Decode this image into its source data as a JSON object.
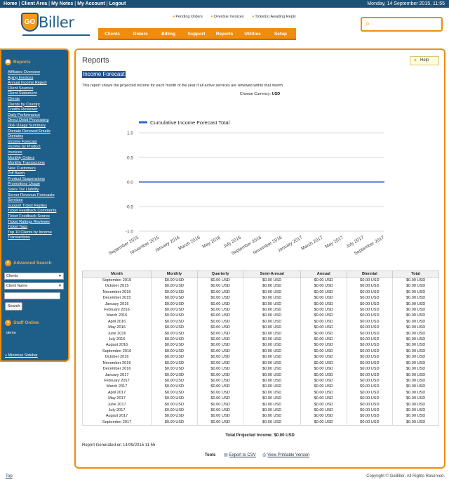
{
  "topbar": {
    "links": [
      "Home",
      "Client Area",
      "My Notes",
      "My Account",
      "Logout"
    ],
    "date": "Monday, 14 September 2015, 11:55"
  },
  "logo": {
    "text": "Biller",
    "badge": "GO"
  },
  "alerts": [
    "Pending Orders",
    "Overdue Invoices",
    "Ticket(s) Awaiting Reply"
  ],
  "nav": [
    "Clients",
    "Orders",
    "Billing",
    "Support",
    "Reports",
    "Utilities",
    "Setup"
  ],
  "sidebar": {
    "reports_heading": "Reports",
    "reports": [
      "Affiliates Overview",
      "Aging Invoices",
      "Annual Income Report",
      "Client Sources",
      "Client Statement",
      "Clients",
      "Clients by Country",
      "Credits Reviewer",
      "Daily Performance",
      "Direct Debit Processing",
      "Disk Usage Summary",
      "Domain Renewal Emails",
      "Domains",
      "Income Forecast",
      "Income by Product",
      "Invoices",
      "Monthly Orders",
      "Monthly Transactions",
      "New Customers",
      "Pdf Batch",
      "Product Suspensions",
      "Promotions Usage",
      "Sales Tax Liability",
      "Server Revenue Forecasts",
      "Services",
      "Support Ticket Replies",
      "Ticket Feedback Comments",
      "Ticket Feedback Scores",
      "Ticket Ratings Reviewer",
      "Ticket Tags",
      "Top 10 Clients by Income",
      "Transactions"
    ],
    "search_heading": "Advanced Search",
    "search_type": "Clients",
    "search_field": "Client Name",
    "search_button": "Search",
    "staff_heading": "Staff Online",
    "staff": "demo",
    "minimise": "« Minimise Sidebar"
  },
  "main": {
    "title": "Reports",
    "help": "Help",
    "report_name": "Income Forecast",
    "description": "This report shows the projected income for each month of the year if all active services are renewed within that month",
    "currency_label": "Choose Currency:",
    "currency": "USD",
    "total": "Total Projected Income: $0.00 USD",
    "generated": "Report Generated on 14/09/2015 11:55",
    "tools_label": "Tools",
    "export_csv": "Export to CSV",
    "printable": "View Printable Version"
  },
  "chart_data": {
    "type": "line",
    "series": [
      {
        "name": "Cumulative Income Forecast Total",
        "color": "#3366cc",
        "values": [
          0,
          0,
          0,
          0,
          0,
          0,
          0,
          0,
          0,
          0,
          0,
          0,
          0,
          0,
          0,
          0,
          0,
          0,
          0,
          0,
          0,
          0,
          0,
          0,
          0
        ]
      }
    ],
    "x_ticks": [
      "September 2015",
      "November 2015",
      "January 2016",
      "March 2016",
      "May 2016",
      "July 2016",
      "September 2016",
      "November 2016",
      "January 2017",
      "March 2017",
      "May 2017",
      "July 2017",
      "September 2017"
    ],
    "y_ticks": [
      "1.0",
      "0.5",
      "0.0",
      "-0.5",
      "-1.0"
    ],
    "ylim": [
      -1,
      1
    ],
    "legend_position": "top-left"
  },
  "table": {
    "headers": [
      "Month",
      "Monthly",
      "Quarterly",
      "Semi-Annual",
      "Annual",
      "Biennial",
      "Total"
    ],
    "rows": [
      [
        "September 2015",
        "$0.00 USD",
        "$0.00 USD",
        "$0.00 USD",
        "$0.00 USD",
        "$0.00 USD",
        "$0.00 USD"
      ],
      [
        "October 2015",
        "$0.00 USD",
        "$0.00 USD",
        "$0.00 USD",
        "$0.00 USD",
        "$0.00 USD",
        "$0.00 USD"
      ],
      [
        "November 2015",
        "$0.00 USD",
        "$0.00 USD",
        "$0.00 USD",
        "$0.00 USD",
        "$0.00 USD",
        "$0.00 USD"
      ],
      [
        "December 2015",
        "$0.00 USD",
        "$0.00 USD",
        "$0.00 USD",
        "$0.00 USD",
        "$0.00 USD",
        "$0.00 USD"
      ],
      [
        "January 2016",
        "$0.00 USD",
        "$0.00 USD",
        "$0.00 USD",
        "$0.00 USD",
        "$0.00 USD",
        "$0.00 USD"
      ],
      [
        "February 2016",
        "$0.00 USD",
        "$0.00 USD",
        "$0.00 USD",
        "$0.00 USD",
        "$0.00 USD",
        "$0.00 USD"
      ],
      [
        "March 2016",
        "$0.00 USD",
        "$0.00 USD",
        "$0.00 USD",
        "$0.00 USD",
        "$0.00 USD",
        "$0.00 USD"
      ],
      [
        "April 2016",
        "$0.00 USD",
        "$0.00 USD",
        "$0.00 USD",
        "$0.00 USD",
        "$0.00 USD",
        "$0.00 USD"
      ],
      [
        "May 2016",
        "$0.00 USD",
        "$0.00 USD",
        "$0.00 USD",
        "$0.00 USD",
        "$0.00 USD",
        "$0.00 USD"
      ],
      [
        "June 2016",
        "$0.00 USD",
        "$0.00 USD",
        "$0.00 USD",
        "$0.00 USD",
        "$0.00 USD",
        "$0.00 USD"
      ],
      [
        "July 2016",
        "$0.00 USD",
        "$0.00 USD",
        "$0.00 USD",
        "$0.00 USD",
        "$0.00 USD",
        "$0.00 USD"
      ],
      [
        "August 2016",
        "$0.00 USD",
        "$0.00 USD",
        "$0.00 USD",
        "$0.00 USD",
        "$0.00 USD",
        "$0.00 USD"
      ],
      [
        "September 2016",
        "$0.00 USD",
        "$0.00 USD",
        "$0.00 USD",
        "$0.00 USD",
        "$0.00 USD",
        "$0.00 USD"
      ],
      [
        "October 2016",
        "$0.00 USD",
        "$0.00 USD",
        "$0.00 USD",
        "$0.00 USD",
        "$0.00 USD",
        "$0.00 USD"
      ],
      [
        "November 2016",
        "$0.00 USD",
        "$0.00 USD",
        "$0.00 USD",
        "$0.00 USD",
        "$0.00 USD",
        "$0.00 USD"
      ],
      [
        "December 2016",
        "$0.00 USD",
        "$0.00 USD",
        "$0.00 USD",
        "$0.00 USD",
        "$0.00 USD",
        "$0.00 USD"
      ],
      [
        "January 2017",
        "$0.00 USD",
        "$0.00 USD",
        "$0.00 USD",
        "$0.00 USD",
        "$0.00 USD",
        "$0.00 USD"
      ],
      [
        "February 2017",
        "$0.00 USD",
        "$0.00 USD",
        "$0.00 USD",
        "$0.00 USD",
        "$0.00 USD",
        "$0.00 USD"
      ],
      [
        "March 2017",
        "$0.00 USD",
        "$0.00 USD",
        "$0.00 USD",
        "$0.00 USD",
        "$0.00 USD",
        "$0.00 USD"
      ],
      [
        "April 2017",
        "$0.00 USD",
        "$0.00 USD",
        "$0.00 USD",
        "$0.00 USD",
        "$0.00 USD",
        "$0.00 USD"
      ],
      [
        "May 2017",
        "$0.00 USD",
        "$0.00 USD",
        "$0.00 USD",
        "$0.00 USD",
        "$0.00 USD",
        "$0.00 USD"
      ],
      [
        "June 2017",
        "$0.00 USD",
        "$0.00 USD",
        "$0.00 USD",
        "$0.00 USD",
        "$0.00 USD",
        "$0.00 USD"
      ],
      [
        "July 2017",
        "$0.00 USD",
        "$0.00 USD",
        "$0.00 USD",
        "$0.00 USD",
        "$0.00 USD",
        "$0.00 USD"
      ],
      [
        "August 2017",
        "$0.00 USD",
        "$0.00 USD",
        "$0.00 USD",
        "$0.00 USD",
        "$0.00 USD",
        "$0.00 USD"
      ],
      [
        "September 2017",
        "$0.00 USD",
        "$0.00 USD",
        "$0.00 USD",
        "$0.00 USD",
        "$0.00 USD",
        "$0.00 USD"
      ]
    ]
  },
  "footer": {
    "top": "Top",
    "copyright": "Copyright © GoBiller. All Rights Reserved."
  }
}
